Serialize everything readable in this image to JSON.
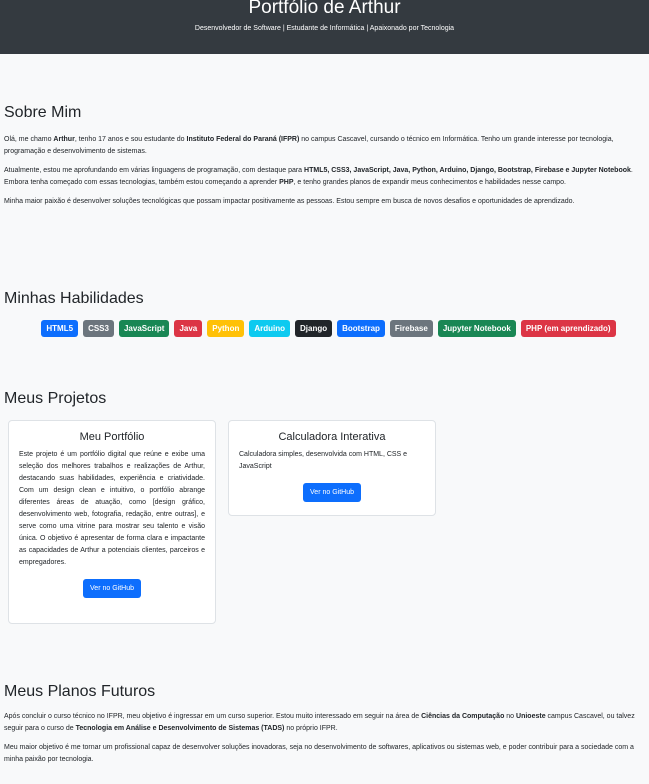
{
  "header": {
    "title": "Portfólio de Arthur",
    "subtitle": "Desenvolvedor de Software | Estudante de Informática | Apaixonado por Tecnologia"
  },
  "about": {
    "heading": "Sobre Mim",
    "p1": {
      "a": "Olá, me chamo ",
      "b1": "Arthur",
      "c": ", tenho 17 anos e sou estudante do ",
      "b2": "Instituto Federal do Paraná (IFPR)",
      "d": " no campus Cascavel, cursando o técnico em Informática. Tenho um grande interesse por tecnologia, programação e desenvolvimento de sistemas."
    },
    "p2": {
      "a": "Atualmente, estou me aprofundando em várias linguagens de programação, com destaque para ",
      "b1": "HTML5, CSS3, JavaScript, Java, Python, Arduino, Django, Bootstrap, Firebase e Jupyter Notebook",
      "c": ". Embora tenha começado com essas tecnologias, também estou começando a aprender ",
      "b2": "PHP",
      "d": ", e tenho grandes planos de expandir meus conhecimentos e habilidades nesse campo."
    },
    "p3": "Minha maior paixão é desenvolver soluções tecnológicas que possam impactar positivamente as pessoas. Estou sempre em busca de novos desafios e oportunidades de aprendizado."
  },
  "skills": {
    "heading": "Minhas Habilidades",
    "badges": [
      {
        "label": "HTML5",
        "color": "#0d6efd"
      },
      {
        "label": "CSS3",
        "color": "#6c757d"
      },
      {
        "label": "JavaScript",
        "color": "#198754"
      },
      {
        "label": "Java",
        "color": "#dc3545"
      },
      {
        "label": "Python",
        "color": "#ffc107"
      },
      {
        "label": "Arduino",
        "color": "#0dcaf0"
      },
      {
        "label": "Django",
        "color": "#212529"
      },
      {
        "label": "Bootstrap",
        "color": "#0d6efd"
      },
      {
        "label": "Firebase",
        "color": "#6c757d"
      },
      {
        "label": "Jupyter Notebook",
        "color": "#198754"
      },
      {
        "label": "PHP (em aprendizado)",
        "color": "#dc3545"
      }
    ]
  },
  "projects": {
    "heading": "Meus Projetos",
    "items": [
      {
        "title": "Meu Portfólio",
        "description": "Este projeto é um portfólio digital que reúne e exibe uma seleção dos melhores trabalhos e realizações de Arthur, destacando suas habilidades, experiência e criatividade. Com um design clean e intuitivo, o portfólio abrange diferentes áreas de atuação, como [design gráfico, desenvolvimento web, fotografia, redação, entre outras], e serve como uma vitrine para mostrar seu talento e visão única. O objetivo é apresentar de forma clara e impactante as capacidades de Arthur a potenciais clientes, parceiros e empregadores.",
        "button": "Ver no GitHub"
      },
      {
        "title": "Calculadora Interativa",
        "description": "Calculadora simples, desenvolvida com HTML, CSS e JavaScript",
        "button": "Ver no GitHub"
      }
    ]
  },
  "future": {
    "heading": "Meus Planos Futuros",
    "p1": {
      "a": "Após concluir o curso técnico no IFPR, meu objetivo é ingressar em um curso superior. Estou muito interessado em seguir na área de ",
      "b1": "Ciências da Computação",
      "c": " no ",
      "b2": "Unioeste",
      "d": " campus Cascavel, ou talvez seguir para o curso de ",
      "b3": "Tecnologia em Análise e Desenvolvimento de Sistemas (TADS)",
      "e": " no próprio IFPR."
    },
    "p2": "Meu maior objetivo é me tornar um profissional capaz de desenvolver soluções inovadoras, seja no desenvolvimento de softwares, aplicativos ou sistemas web, e poder contribuir para a sociedade com a minha paixão por tecnologia."
  }
}
